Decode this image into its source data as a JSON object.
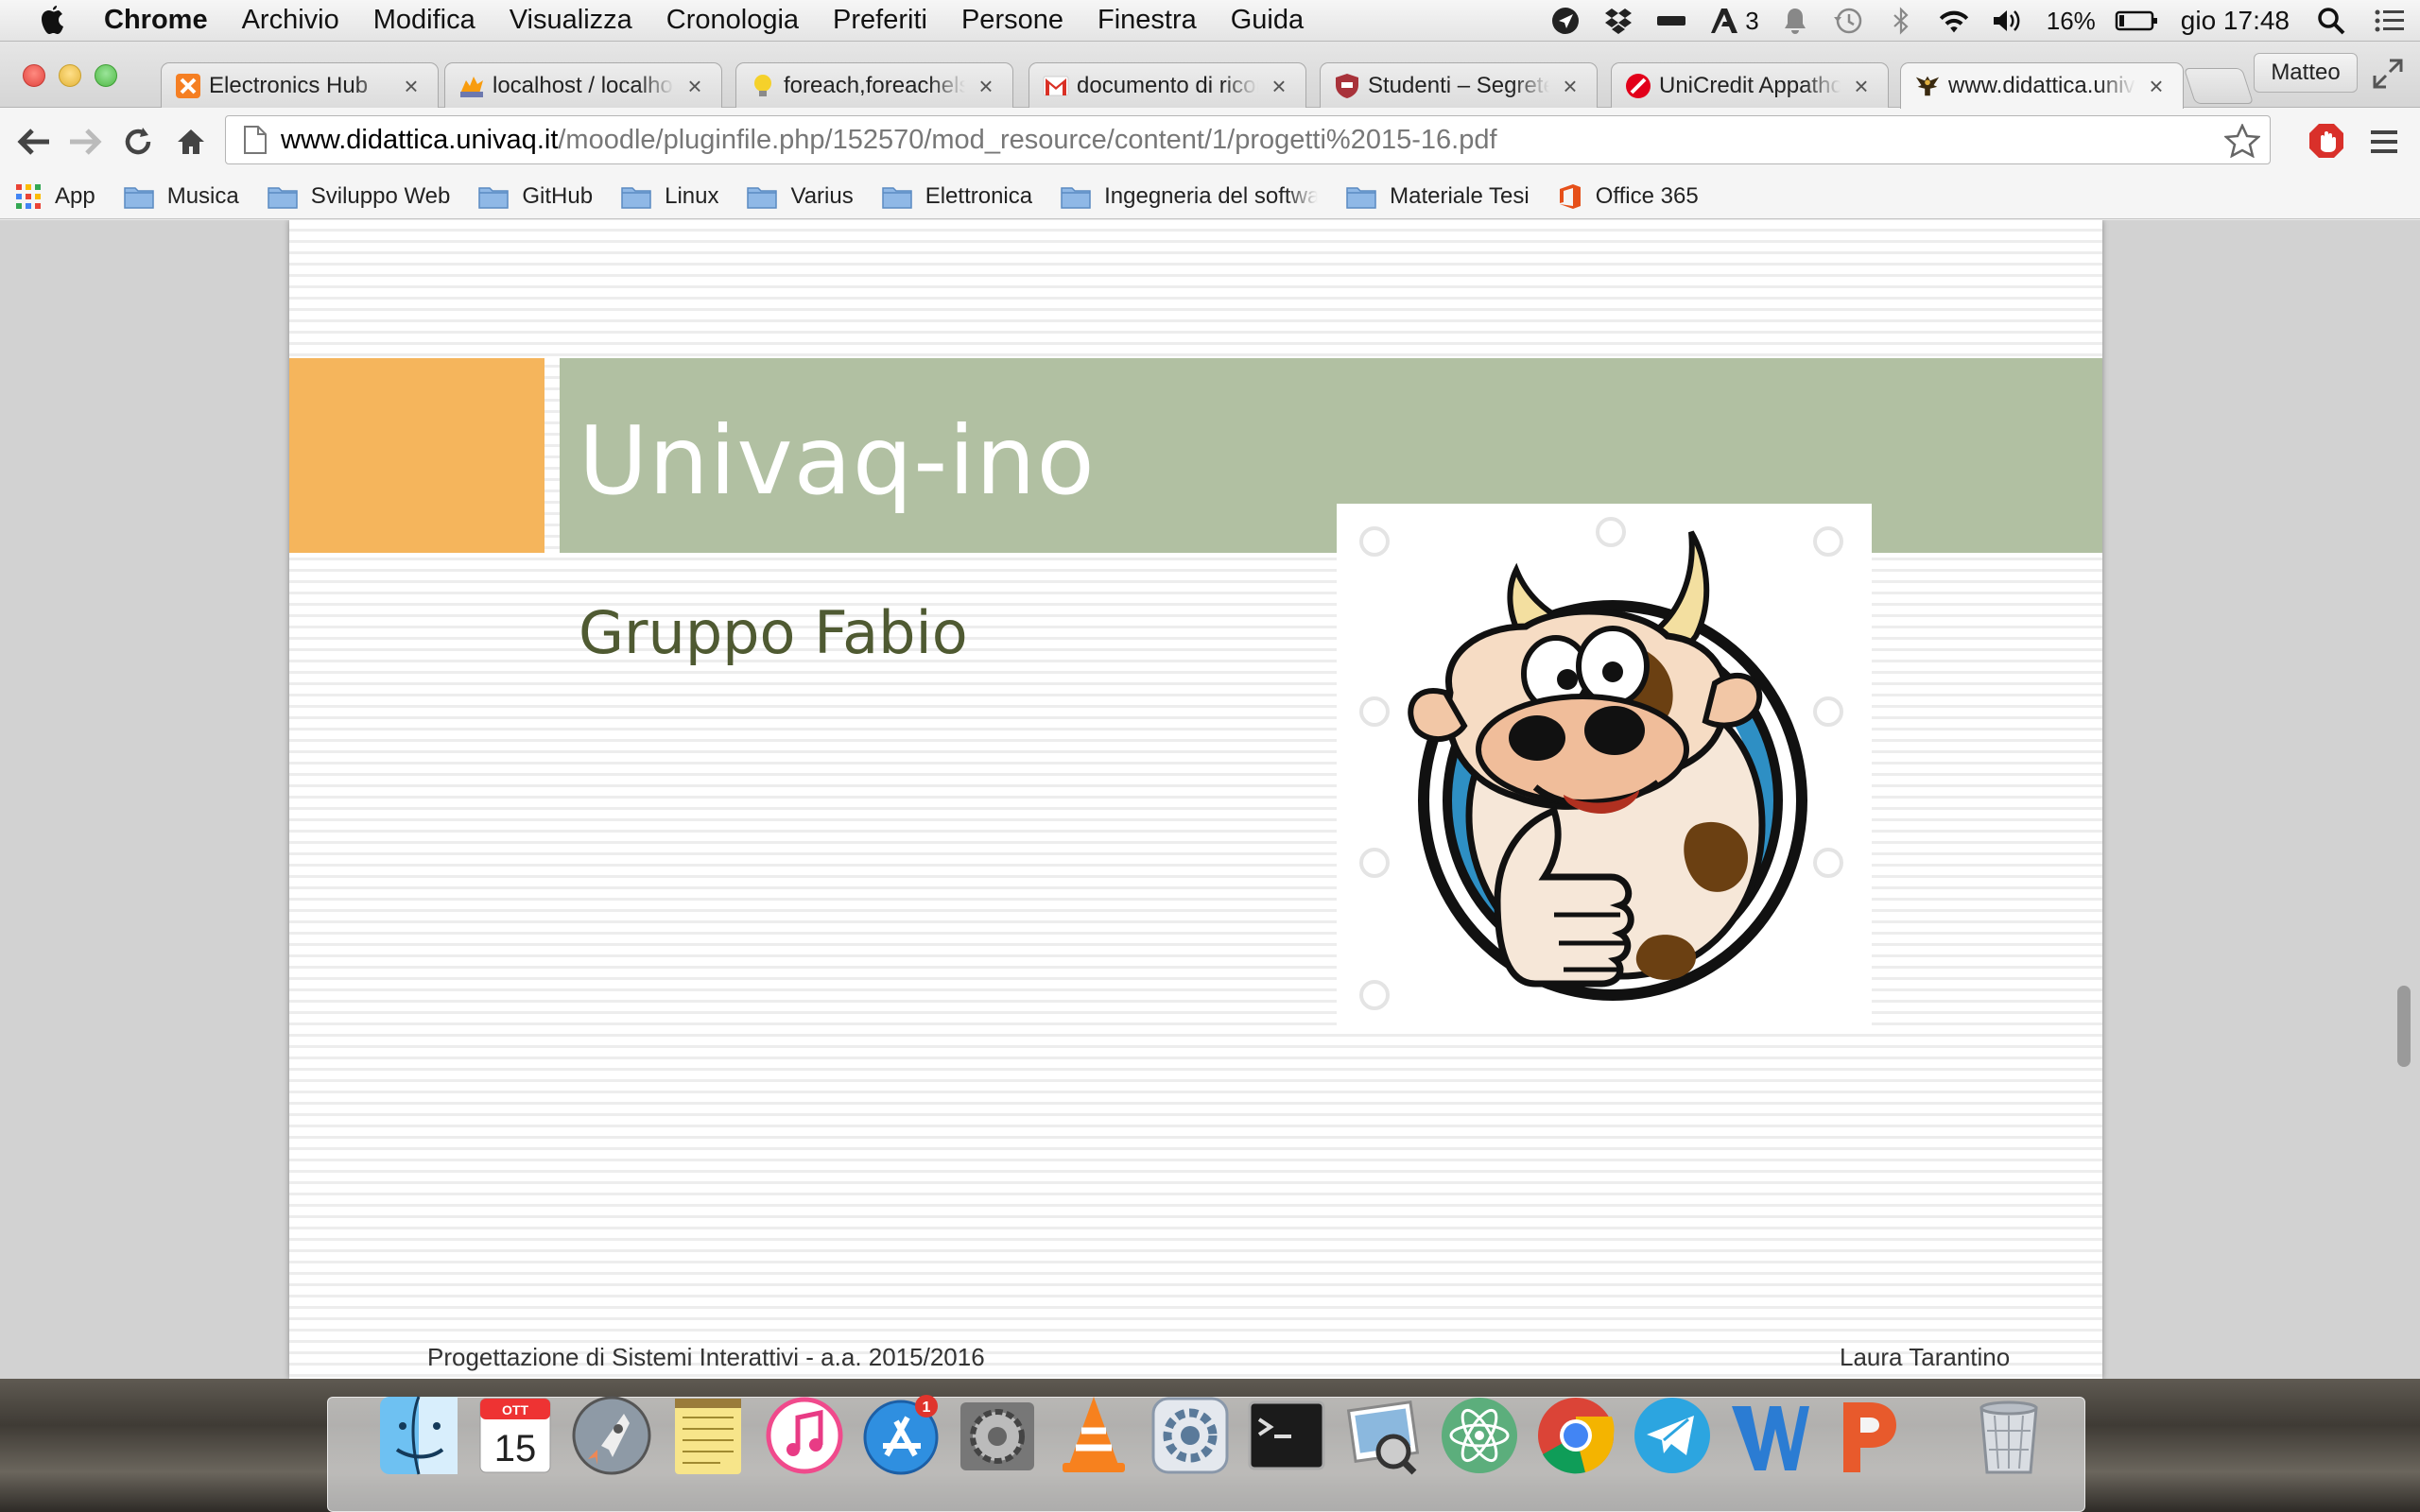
{
  "menubar": {
    "app_name": "Chrome",
    "items": [
      "Archivio",
      "Modifica",
      "Visualizza",
      "Cronologia",
      "Preferiti",
      "Persone",
      "Finestra",
      "Guida"
    ],
    "status": {
      "adobe_count": "3",
      "battery": "16%",
      "clock": "gio 17:48"
    }
  },
  "tabs": [
    {
      "title": "Electronics Hub",
      "icon": "xampp-icon"
    },
    {
      "title": "localhost / localhost",
      "icon": "phpmyadmin-icon"
    },
    {
      "title": "foreach,foreachelse",
      "icon": "lightbulb-icon"
    },
    {
      "title": "documento di ricono",
      "icon": "gmail-icon"
    },
    {
      "title": "Studenti – Segreteria",
      "icon": "shield-icon"
    },
    {
      "title": "UniCredit Appathon",
      "icon": "unicredit-icon"
    },
    {
      "title": "www.didattica.univaq",
      "icon": "univaq-eagle-icon",
      "active": true
    }
  ],
  "profile_name": "Matteo",
  "address_bar": {
    "host": "www.didattica.univaq.it",
    "path": "/moodle/pluginfile.php/152570/mod_resource/content/1/progetti%2015-16.pdf"
  },
  "bookmarks": [
    {
      "label": "App",
      "icon": "apps-grid-icon"
    },
    {
      "label": "Musica",
      "icon": "folder-icon"
    },
    {
      "label": "Sviluppo Web",
      "icon": "folder-icon"
    },
    {
      "label": "GitHub",
      "icon": "folder-icon"
    },
    {
      "label": "Linux",
      "icon": "folder-icon"
    },
    {
      "label": "Varius",
      "icon": "folder-icon"
    },
    {
      "label": "Elettronica",
      "icon": "folder-icon"
    },
    {
      "label": "Ingegneria del software",
      "icon": "folder-icon"
    },
    {
      "label": "Materiale Tesi",
      "icon": "folder-icon"
    },
    {
      "label": "Office 365",
      "icon": "office-icon"
    }
  ],
  "slide": {
    "title": "Univaq-ino",
    "subtitle": "Gruppo Fabio",
    "footer_left": "Progettazione di Sistemi Interattivi - a.a. 2015/2016",
    "footer_right": "Laura Tarantino",
    "image": "cartoon-cow-thumbs-up",
    "colors": {
      "accent_orange": "#f5b55c",
      "title_band": "#b1c0a2",
      "subtitle_text": "#4f5a32"
    }
  },
  "dock": {
    "calendar_month": "OTT",
    "calendar_day": "15",
    "appstore_badge": "1",
    "apps": [
      "finder-icon",
      "calendar-icon",
      "launchpad-icon",
      "notes-icon",
      "itunes-icon",
      "app-store-icon",
      "system-preferences-icon",
      "vlc-icon",
      "settings-icon",
      "terminal-icon",
      "preview-icon",
      "atom-icon",
      "chrome-icon",
      "telegram-icon",
      "word-icon",
      "powerpoint-icon",
      "trash-icon"
    ]
  }
}
